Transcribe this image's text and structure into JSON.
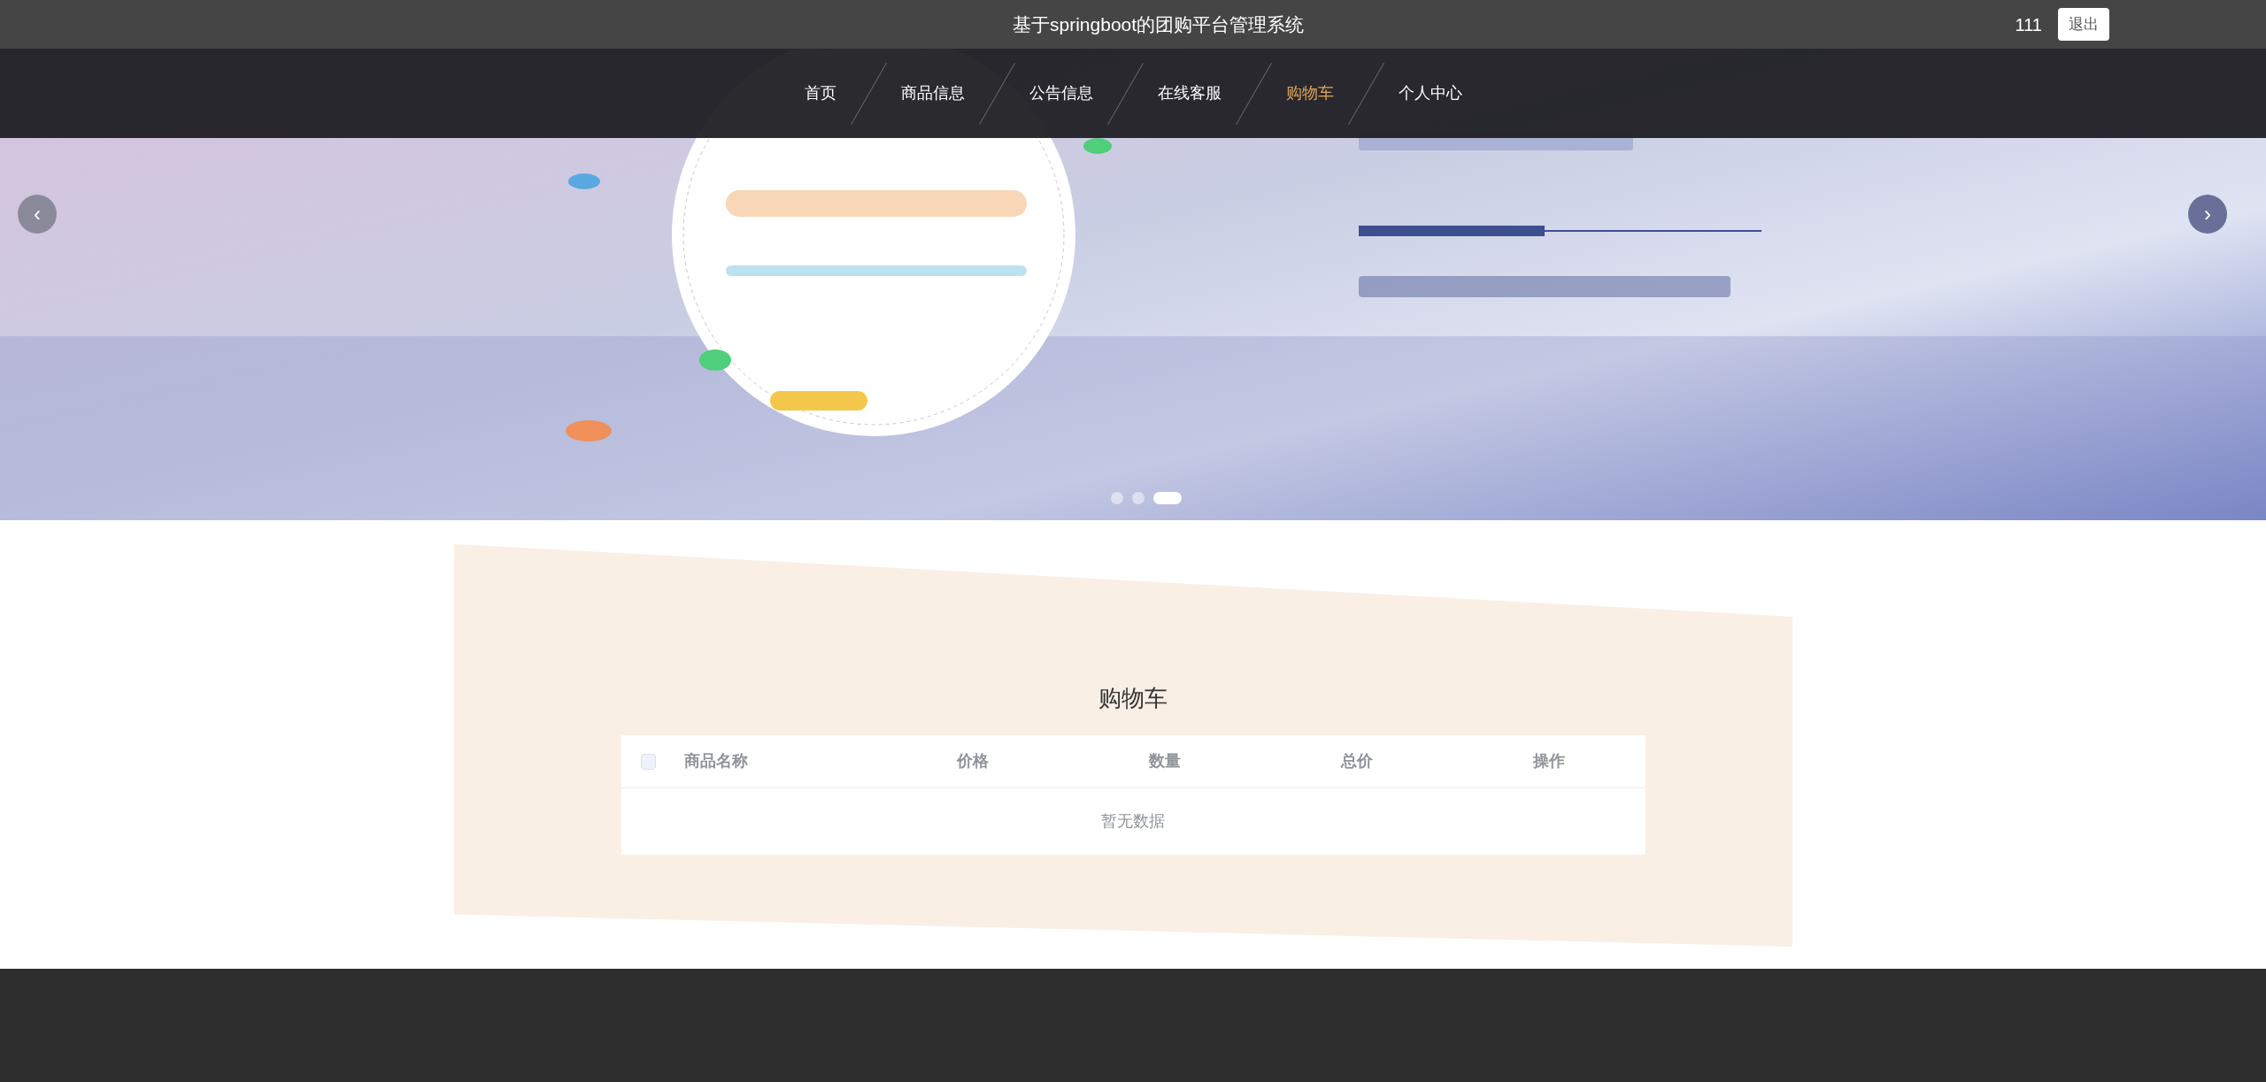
{
  "header": {
    "title": "基于springboot的团购平台管理系统",
    "user": "111",
    "logout": "退出"
  },
  "nav": [
    {
      "label": "首页",
      "selected": false
    },
    {
      "label": "商品信息",
      "selected": false
    },
    {
      "label": "公告信息",
      "selected": false
    },
    {
      "label": "在线客服",
      "selected": false
    },
    {
      "label": "购物车",
      "selected": true
    },
    {
      "label": "个人中心",
      "selected": false
    }
  ],
  "carousel": {
    "prev": "‹",
    "next": "›",
    "dots": [
      {
        "selected": false
      },
      {
        "selected": false
      },
      {
        "selected": true
      }
    ]
  },
  "cart": {
    "title": "购物车",
    "select_all": {
      "checked": false
    },
    "columns": [
      "商品名称",
      "价格",
      "数量",
      "总价",
      "操作"
    ],
    "empty": "暂无数据"
  }
}
